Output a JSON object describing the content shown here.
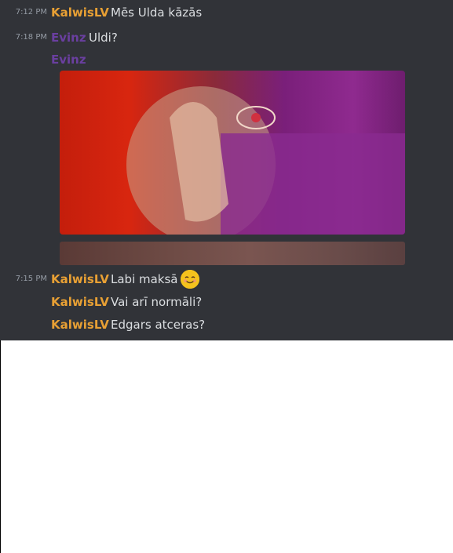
{
  "messages": [
    {
      "time": "7:12 PM",
      "user": "KalwisLV",
      "text": "Mēs Ulda kāzās"
    },
    {
      "time": "7:18 PM",
      "user": "Evinz",
      "text": "Uldi?"
    },
    {
      "user": "Evinz"
    },
    {
      "time": "7:15 PM",
      "user": "KalwisLV",
      "text": "Labi maksā",
      "emoji": "smiling-face-with-blush"
    },
    {
      "user": "KalwisLV",
      "text": "Vai arī normāli?"
    },
    {
      "user": "KalwisLV",
      "text": "Edgars atceras?"
    }
  ],
  "colors": {
    "kalwis": "#e8a034",
    "evinz": "#6a3fa0",
    "background": "#313338",
    "text": "#dbdee1"
  }
}
